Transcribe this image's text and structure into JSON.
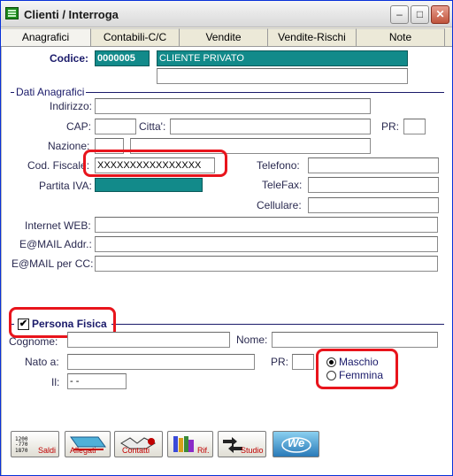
{
  "window": {
    "title": "Clienti / Interroga",
    "min": "–",
    "max": "□",
    "close": "✕"
  },
  "tabs": [
    "Anagrafici",
    "Contabili-C/C",
    "Vendite",
    "Vendite-Rischi",
    "Note"
  ],
  "header": {
    "codice_label": "Codice:",
    "codice_value": "0000005",
    "name_value": "CLIENTE PRIVATO"
  },
  "anagrafici": {
    "section": "Dati Anagrafici",
    "indirizzo": "Indirizzo:",
    "cap": "CAP:",
    "citta": "Citta':",
    "pr": "PR:",
    "nazione": "Nazione:",
    "cod_fiscale": "Cod. Fiscale:",
    "cod_fiscale_value": "XXXXXXXXXXXXXXXX",
    "partita_iva": "Partita IVA:",
    "telefono": "Telefono:",
    "telefax": "TeleFax:",
    "cellulare": "Cellulare:",
    "internet": "Internet WEB:",
    "email": "E@MAIL Addr.:",
    "email_cc": "E@MAIL per CC:"
  },
  "persona": {
    "section": "Persona Fisica",
    "checked": "✔",
    "cognome": "Cognome:",
    "nome": "Nome:",
    "nato": "Nato a:",
    "pr": "PR:",
    "il": "Il:",
    "il_value": "- -",
    "maschio": "Maschio",
    "femmina": "Femmina"
  },
  "buttons": [
    "Saldi",
    "Allegati",
    "Contatti",
    "Rif.",
    "Studio",
    "We"
  ],
  "colors": {
    "teal": "#128a8a",
    "highlight": "#e8141c",
    "label": "#2a2a50"
  }
}
